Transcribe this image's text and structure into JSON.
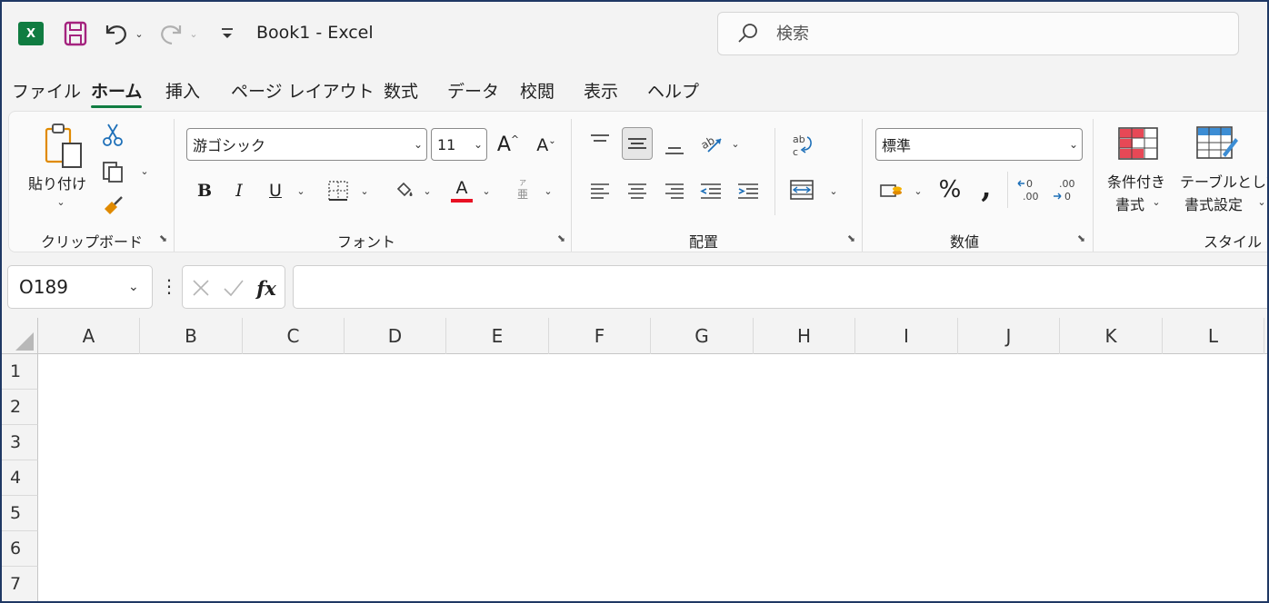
{
  "title_bar": {
    "app_logo": "X",
    "doc_title": "Book1  -  Excel",
    "search_placeholder": "検索",
    "icons": [
      "excel-logo-icon",
      "save-icon",
      "undo-icon",
      "redo-icon",
      "customize-qat-icon",
      "search-icon"
    ]
  },
  "tabs": [
    {
      "label": "ファイル",
      "active": false
    },
    {
      "label": "ホーム",
      "active": true
    },
    {
      "label": "挿入",
      "active": false
    },
    {
      "label": "ページ レイアウト",
      "active": false
    },
    {
      "label": "数式",
      "active": false
    },
    {
      "label": "データ",
      "active": false
    },
    {
      "label": "校閲",
      "active": false
    },
    {
      "label": "表示",
      "active": false
    },
    {
      "label": "ヘルプ",
      "active": false
    }
  ],
  "ribbon": {
    "clipboard": {
      "label": "クリップボード",
      "paste_label": "貼り付け"
    },
    "font": {
      "label": "フォント",
      "font_name": "游ゴシック",
      "font_size": "11",
      "bold": "B",
      "italic": "I",
      "underline": "U",
      "font_color_letter": "A",
      "phonetic_letter": "亜",
      "font_color_hex": "#e81123"
    },
    "alignment": {
      "label": "配置"
    },
    "number": {
      "label": "数値",
      "format": "標準",
      "percent": "%",
      "comma": ","
    },
    "styles": {
      "label": "スタイル",
      "conditional_line1": "条件付き",
      "conditional_line2": "書式",
      "table_line1": "テーブルとして",
      "table_line2": "書式設定"
    }
  },
  "formula_bar": {
    "name_box": "O189",
    "formula": "",
    "fx_label": "fx"
  },
  "grid": {
    "columns": [
      "A",
      "B",
      "C",
      "D",
      "E",
      "F",
      "G",
      "H",
      "I",
      "J",
      "K",
      "L"
    ],
    "rows": [
      "1",
      "2",
      "3",
      "4",
      "5",
      "6",
      "7"
    ]
  },
  "colors": {
    "accent": "#107c41",
    "frame_border": "#1f3864",
    "save_icon": "#a4237e"
  }
}
